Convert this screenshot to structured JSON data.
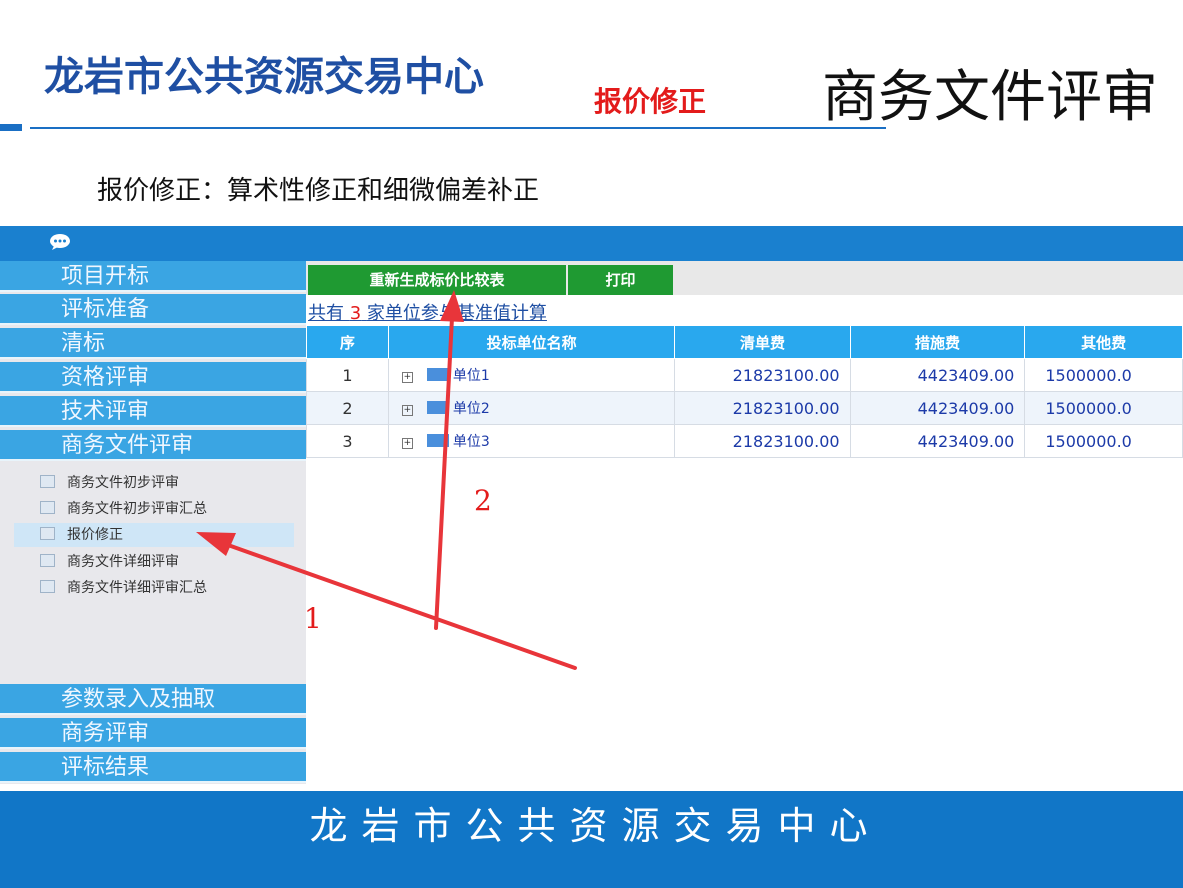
{
  "header": {
    "org_title": "龙岩市公共资源交易中心",
    "section_tag": "报价修正",
    "page_heading": "商务文件评审",
    "accent_color": "#1a6fc4"
  },
  "caption": "报价修正：算术性修正和细微偏差补正",
  "app": {
    "topbar_icon": "chat-bubble-icon",
    "sidebar": {
      "top_items": [
        "项目开标",
        "评标准备",
        "清标",
        "资格评审",
        "技术评审",
        "商务文件评审"
      ],
      "sub_items": [
        "商务文件初步评审",
        "商务文件初步评审汇总",
        "报价修正",
        "商务文件详细评审",
        "商务文件详细评审汇总"
      ],
      "active_sub": "报价修正",
      "bottom_items": [
        "参数录入及抽取",
        "商务评审",
        "评标结果"
      ]
    },
    "toolbar": {
      "regenerate_label": "重新生成标价比较表",
      "print_label": "打印"
    },
    "summary": {
      "prefix": "共有",
      "count": "3",
      "suffix": "家单位参与基准值计算"
    },
    "table": {
      "headers": [
        "序",
        "投标单位名称",
        "清单费",
        "措施费",
        "其他费"
      ],
      "rows": [
        {
          "seq": "1",
          "name": "单位1",
          "list_fee": "21823100.00",
          "measure_fee": "4423409.00",
          "other_fee": "1500000.0"
        },
        {
          "seq": "2",
          "name": "单位2",
          "list_fee": "21823100.00",
          "measure_fee": "4423409.00",
          "other_fee": "1500000.0"
        },
        {
          "seq": "3",
          "name": "单位3",
          "list_fee": "21823100.00",
          "measure_fee": "4423409.00",
          "other_fee": "1500000.0"
        }
      ]
    }
  },
  "annotations": {
    "step1": "1",
    "step2": "2",
    "arrow_color": "#e31b1b"
  },
  "footer": {
    "text": "龙岩市公共资源交易中心"
  }
}
